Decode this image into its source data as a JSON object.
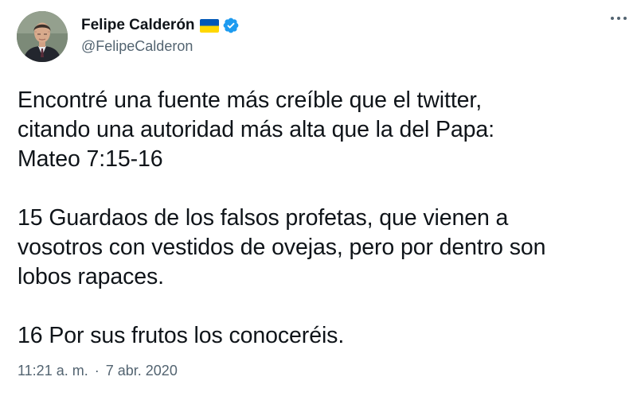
{
  "author": {
    "display_name": "Felipe Calderón",
    "handle": "@FelipeCalderon",
    "flag_icon": "ukraine-flag-icon",
    "verified_icon": "verified-badge-icon",
    "flag_colors": {
      "top": "#0057b7",
      "bottom": "#ffd700"
    },
    "verified_color": "#1d9bf0"
  },
  "menu": {
    "more_icon": "more-horizontal-icon"
  },
  "tweet": {
    "paragraphs": [
      {
        "lines": [
          "Encontré una fuente más creíble que el twitter,",
          "citando una autoridad más alta que la del Papa:",
          "Mateo 7:15-16"
        ]
      },
      {
        "lines": [
          "15 Guardaos de los falsos profetas, que vienen a",
          "vosotros con vestidos de ovejas, pero por dentro son",
          "lobos rapaces."
        ]
      },
      {
        "lines": [
          "16 Por sus frutos los conoceréis."
        ]
      }
    ]
  },
  "meta": {
    "time": "11:21 a. m.",
    "separator": "·",
    "date": "7 abr. 2020"
  }
}
